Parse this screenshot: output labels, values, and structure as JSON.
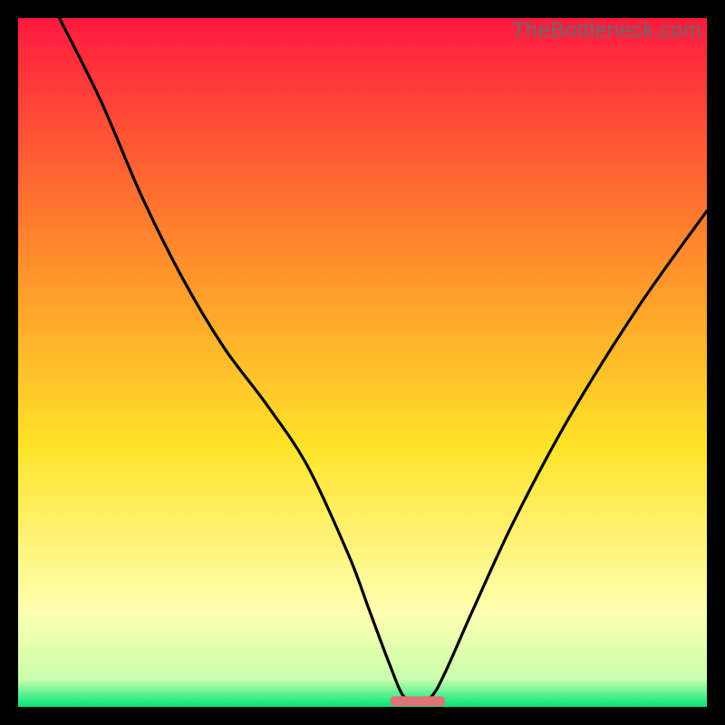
{
  "watermark": "TheBottleneck.com",
  "colors": {
    "red": "#ff1a3f",
    "orange": "#ff8b2c",
    "yellow": "#ffe329",
    "paleyellow": "#ffffb0",
    "green": "#00e57a",
    "black": "#000000",
    "marker": "#e07373"
  },
  "chart_data": {
    "type": "line",
    "title": "",
    "xlabel": "",
    "ylabel": "",
    "xlim": [
      0,
      100
    ],
    "ylim": [
      0,
      100
    ],
    "note": "Background is a vertical gradient red→orange→yellow→pale→green. Curve is a black V-shaped bottleneck dip touching y≈0 near x≈57, with a short salmon marker segment at the trough. Values are visual estimates in percent of plot width/height.",
    "series": [
      {
        "name": "bottleneck-curve",
        "x": [
          6,
          12,
          18,
          24,
          30,
          36,
          42,
          48,
          51,
          54,
          56,
          58,
          60,
          62,
          66,
          72,
          80,
          90,
          100
        ],
        "y": [
          100,
          88,
          74,
          62,
          52,
          44,
          35,
          22,
          14,
          6,
          1.5,
          1.0,
          1.5,
          5,
          14,
          27,
          42,
          58,
          72
        ]
      }
    ],
    "marker": {
      "x_start": 54,
      "x_end": 62,
      "y": 0.9
    },
    "gradient_stops": [
      {
        "offset": 0,
        "color": "#ff1a3f"
      },
      {
        "offset": 34,
        "color": "#ff8b2c"
      },
      {
        "offset": 62,
        "color": "#ffe329"
      },
      {
        "offset": 86,
        "color": "#ffffb0"
      },
      {
        "offset": 96,
        "color": "#c9ffad"
      },
      {
        "offset": 100,
        "color": "#00e57a"
      }
    ]
  }
}
